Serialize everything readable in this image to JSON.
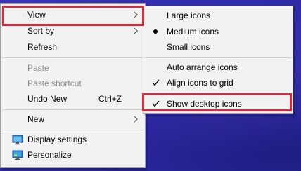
{
  "context_menu": {
    "items": [
      {
        "label": "View"
      },
      {
        "label": "Sort by"
      },
      {
        "label": "Refresh"
      },
      {
        "label": "Paste"
      },
      {
        "label": "Paste shortcut"
      },
      {
        "label": "Undo New",
        "shortcut": "Ctrl+Z"
      },
      {
        "label": "New"
      },
      {
        "label": "Display settings"
      },
      {
        "label": "Personalize"
      }
    ]
  },
  "view_submenu": {
    "items": [
      {
        "label": "Large icons"
      },
      {
        "label": "Medium icons"
      },
      {
        "label": "Small icons"
      },
      {
        "label": "Auto arrange icons"
      },
      {
        "label": "Align icons to grid"
      },
      {
        "label": "Show desktop icons"
      }
    ]
  },
  "colors": {
    "highlight": "#d8283a",
    "menu_background": "#f2f2f2",
    "desktop": "#2f2fb4"
  }
}
